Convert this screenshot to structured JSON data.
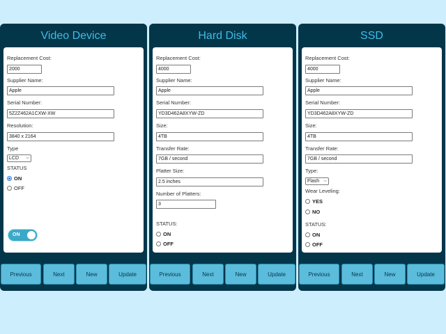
{
  "colors": {
    "background": "#cdeffd",
    "panel": "#04364a",
    "title": "#3ebde6",
    "button": "#5bbcdc",
    "radio_accent": "#1a73e8"
  },
  "panels": [
    {
      "title": "Video Device",
      "fields": {
        "replacement_cost": {
          "label": "Replacement Cost:",
          "value": "2000"
        },
        "supplier_name": {
          "label": "Supplier Name:",
          "value": "Apple"
        },
        "serial_number": {
          "label": "Serial Number:",
          "value": "5Z2Z462A1CXW-XW"
        },
        "resolution": {
          "label": "Resolution:",
          "value": "3840 x 2164"
        },
        "type": {
          "label": "Type",
          "value": "LCD"
        }
      },
      "status": {
        "label": "STATUS",
        "on": "ON",
        "off": "OFF",
        "selected": "ON"
      },
      "toggle": {
        "label": "ON",
        "state": "on"
      }
    },
    {
      "title": "Hard Disk",
      "fields": {
        "replacement_cost": {
          "label": "Replacement Cost:",
          "value": "4000"
        },
        "supplier_name": {
          "label": "Supplier Name:",
          "value": "Apple"
        },
        "serial_number": {
          "label": "Serial Number:",
          "value": "YD3D462A8XYW-ZD"
        },
        "size": {
          "label": "Size:",
          "value": "4TB"
        },
        "transfer_rate": {
          "label": "Transfer Rate:",
          "value": "7GB / second"
        },
        "platter_size": {
          "label": "Platter Size:",
          "value": "2.5 inches"
        },
        "number_of_platters": {
          "label": "Number of Platters:",
          "value": "3"
        }
      },
      "status": {
        "label": "STATUS:",
        "on": "ON",
        "off": "OFF",
        "selected": ""
      }
    },
    {
      "title": "SSD",
      "fields": {
        "replacement_cost": {
          "label": "Replacement Cost:",
          "value": "4000"
        },
        "supplier_name": {
          "label": "Supplier Name:",
          "value": "Apple"
        },
        "serial_number": {
          "label": "Serial Number:",
          "value": "YD3D462A8XYW-ZD"
        },
        "size": {
          "label": "Size:",
          "value": "4TB"
        },
        "transfer_rate": {
          "label": "Transfer Rate:",
          "value": "7GB / second"
        },
        "type": {
          "label": "Type:",
          "value": "Flash"
        }
      },
      "wear_leveling": {
        "label": "Wear Leveling:",
        "yes": "YES",
        "no": "NO",
        "selected": ""
      },
      "status": {
        "label": "STATUS:",
        "on": "ON",
        "off": "OFF",
        "selected": ""
      }
    }
  ],
  "buttons": {
    "previous": "Previous",
    "next": "Next",
    "new": "New",
    "update": "Update"
  }
}
